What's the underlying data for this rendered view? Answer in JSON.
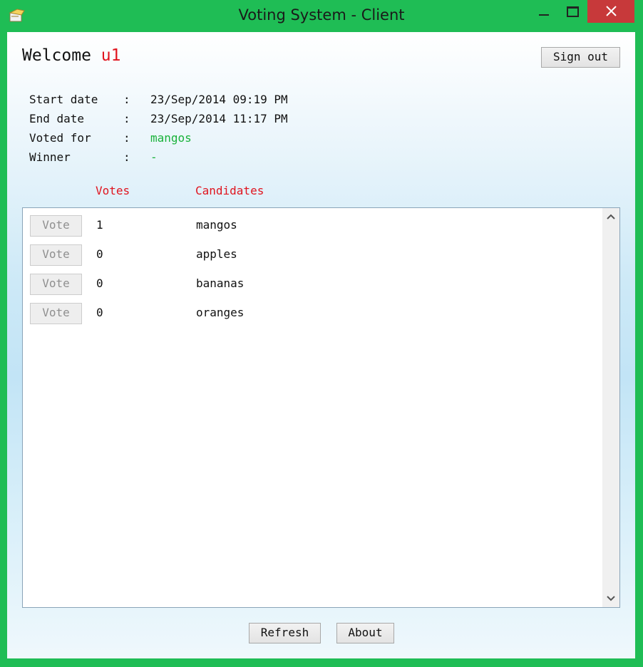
{
  "window": {
    "title": "Voting System - Client"
  },
  "header": {
    "welcome_label": "Welcome",
    "username": "u1",
    "signout_label": "Sign out"
  },
  "info": [
    {
      "label": "Start date",
      "value": "23/Sep/2014 09:19 PM"
    },
    {
      "label": "End date",
      "value": "23/Sep/2014 11:17 PM"
    },
    {
      "label": "Voted for",
      "value": "mangos"
    },
    {
      "label": "Winner",
      "value": "-"
    }
  ],
  "info_separator": ":",
  "table": {
    "headers": {
      "votes": "Votes",
      "candidates": "Candidates"
    },
    "vote_button_label": "Vote",
    "rows": [
      {
        "votes": "1",
        "candidate": "mangos"
      },
      {
        "votes": "0",
        "candidate": "apples"
      },
      {
        "votes": "0",
        "candidate": "bananas"
      },
      {
        "votes": "0",
        "candidate": "oranges"
      }
    ]
  },
  "footer": {
    "refresh_label": "Refresh",
    "about_label": "About"
  },
  "colors": {
    "frame": "#1fbd55",
    "close_button": "#c7393a",
    "accent_red": "#e0141e",
    "accent_green": "#19b23a"
  },
  "icons": {
    "app": "app-icon",
    "minimize": "minimize-icon",
    "maximize": "maximize-icon",
    "close": "close-icon",
    "scroll_up": "chevron-up-icon",
    "scroll_down": "chevron-down-icon"
  }
}
